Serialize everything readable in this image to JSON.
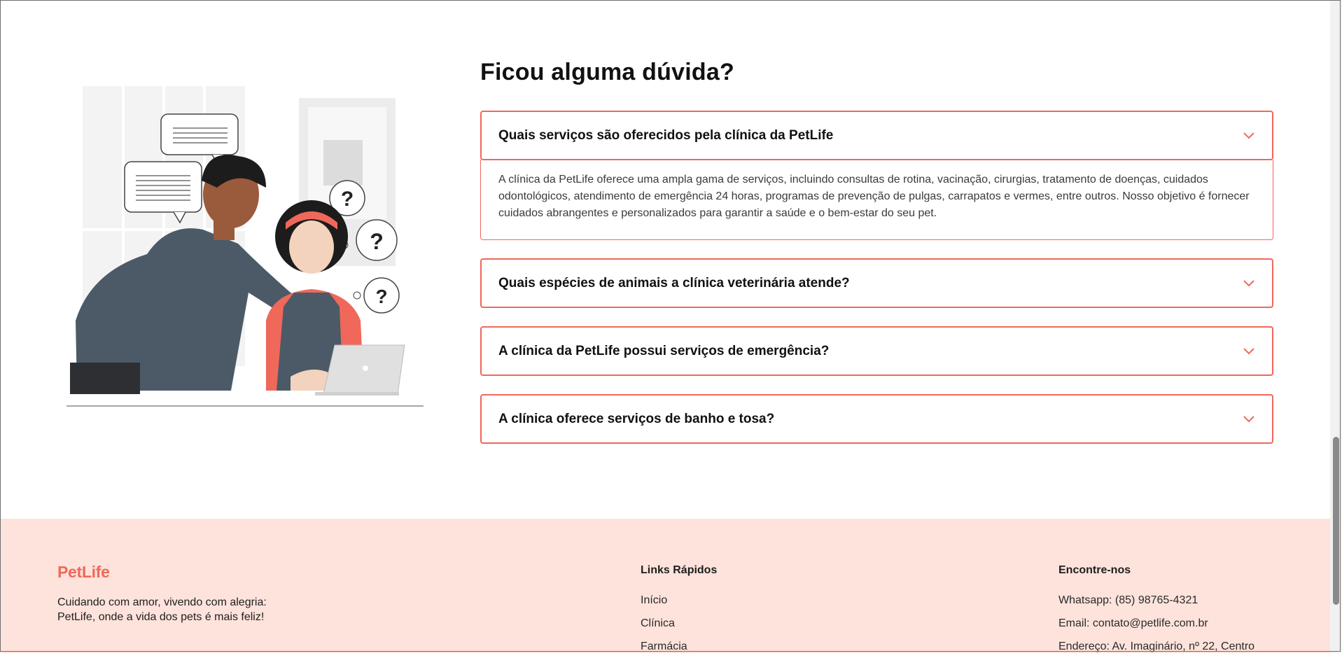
{
  "faq": {
    "title": "Ficou alguma dúvida?",
    "items": [
      {
        "question": "Quais serviços são oferecidos pela clínica da PetLife",
        "answer": "A clínica da PetLife oferece uma ampla gama de serviços, incluindo consultas de rotina, vacinação, cirurgias, tratamento de doenças, cuidados odontológicos, atendimento de emergência 24 horas, programas de prevenção de pulgas, carrapatos e vermes, entre outros. Nosso objetivo é fornecer cuidados abrangentes e personalizados para garantir a saúde e o bem-estar do seu pet.",
        "expanded": true
      },
      {
        "question": "Quais espécies de animais a clínica veterinária atende?",
        "expanded": false
      },
      {
        "question": "A clínica da PetLife possui serviços de emergência?",
        "expanded": false
      },
      {
        "question": "A clínica oferece serviços de banho e tosa?",
        "expanded": false
      }
    ]
  },
  "footer": {
    "brand": "PetLife",
    "tagline_line1": "Cuidando com amor, vivendo com alegria:",
    "tagline_line2": "PetLife, onde a vida dos pets é mais feliz!",
    "links_title": "Links Rápidos",
    "links": [
      "Início",
      "Clínica",
      "Farmácia"
    ],
    "contact_title": "Encontre-nos",
    "contact": [
      "Whatsapp: (85) 98765-4321",
      "Email: contato@petlife.com.br",
      "Endereço: Av. Imaginário, nº 22, Centro"
    ]
  },
  "colors": {
    "accent": "#f0685a",
    "footer_bg": "#fde3db"
  },
  "icons": [
    "chevron-down-icon"
  ]
}
